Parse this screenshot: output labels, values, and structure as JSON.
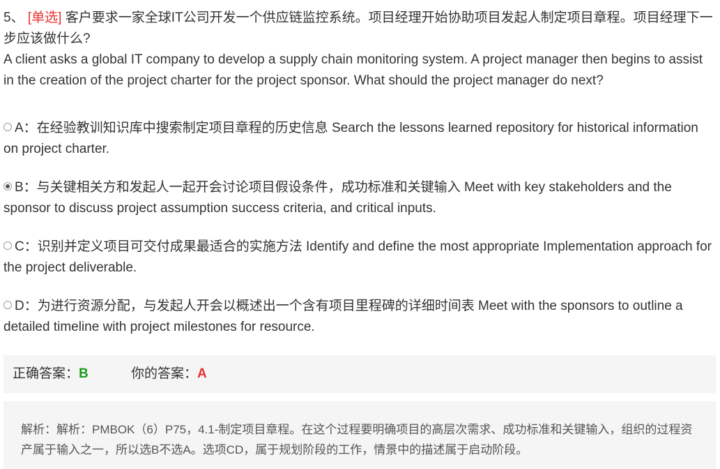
{
  "question": {
    "number": "5、",
    "tag": "[单选]",
    "text_cn": "客户要求一家全球IT公司开发一个供应链监控系统。项目经理开始协助项目发起人制定项目章程。项目经理下一步应该做什么?",
    "text_en": "A client asks a global IT company to develop a supply chain monitoring system. A project manager then begins to assist in the creation of the project charter for the project sponsor. What should the project manager do next?"
  },
  "options": [
    {
      "text": "A：在经验教训知识库中搜索制定项目章程的历史信息 Search the lessons learned repository for historical information on project charter.",
      "selected": false
    },
    {
      "text": "B：与关键相关方和发起人一起开会讨论项目假设条件，成功标准和关键输入 Meet with key stakeholders and the sponsor to discuss project assumption success criteria, and critical inputs.",
      "selected": true
    },
    {
      "text": "C：识别并定义项目可交付成果最适合的实施方法 Identify and define the most appropriate Implementation approach for the project deliverable.",
      "selected": false
    },
    {
      "text": "D：为进行资源分配，与发起人开会以概述出一个含有项目里程碑的详细时间表 Meet with the sponsors to outline a detailed timeline with project milestones for resource.",
      "selected": false
    }
  ],
  "answer": {
    "correct_label": "正确答案：",
    "correct_value": "B",
    "yours_label": "你的答案：",
    "yours_value": "A"
  },
  "analysis": {
    "text": "解析：解析：PMBOK（6）P75，4.1-制定项目章程。在这个过程要明确项目的高层次需求、成功标准和关键输入，组织的过程资产属于输入之一，所以选B不选A。选项CD，属于规划阶段的工作，情景中的描述属于启动阶段。"
  },
  "colors": {
    "tag": "#e8312f",
    "correct": "#1a9c1a",
    "wrong": "#e8312f",
    "panel_bg": "#f5f5f5"
  }
}
